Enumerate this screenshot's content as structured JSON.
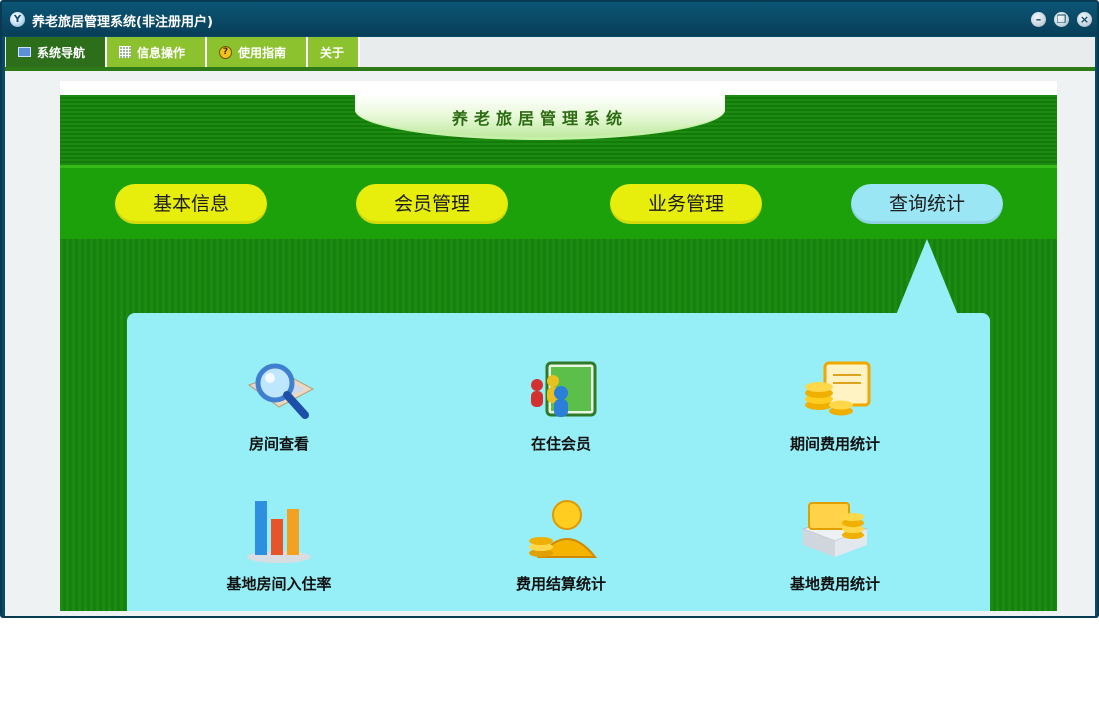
{
  "window": {
    "title": "养老旅居管理系统(非注册用户)",
    "app_icon": "app-logo-icon",
    "controls": [
      "minimize-icon",
      "restore-icon",
      "close-icon"
    ]
  },
  "menu": {
    "items": [
      {
        "label": "系统导航",
        "icon": "monitor-icon"
      },
      {
        "label": "信息操作",
        "icon": "grid-icon"
      },
      {
        "label": "使用指南",
        "icon": "help-icon"
      },
      {
        "label": "关于"
      }
    ]
  },
  "banner": {
    "title": "养老旅居管理系统"
  },
  "nav": {
    "pills": [
      {
        "label": "基本信息"
      },
      {
        "label": "会员管理"
      },
      {
        "label": "业务管理"
      },
      {
        "label": "查询统计",
        "active": true
      }
    ]
  },
  "tiles": [
    {
      "label": "房间查看",
      "icon": "magnifier-map-icon"
    },
    {
      "label": "在住会员",
      "icon": "people-cards-icon"
    },
    {
      "label": "期间费用统计",
      "icon": "coins-document-icon"
    },
    {
      "label": "基地房间入住率",
      "icon": "bar-chart-icon"
    },
    {
      "label": "费用结算统计",
      "icon": "coin-person-icon"
    },
    {
      "label": "基地费用统计",
      "icon": "coins-folder-icon"
    }
  ],
  "colors": {
    "titlebar": "#0a4a66",
    "menu_active": "#2c6e1a",
    "menu_inactive": "#8cc22d",
    "banner_green": "#1b8c10",
    "nav_band": "#1da10b",
    "pill_yellow": "#e7ee0c",
    "pill_active": "#9be6f4",
    "card": "#96eef6"
  }
}
